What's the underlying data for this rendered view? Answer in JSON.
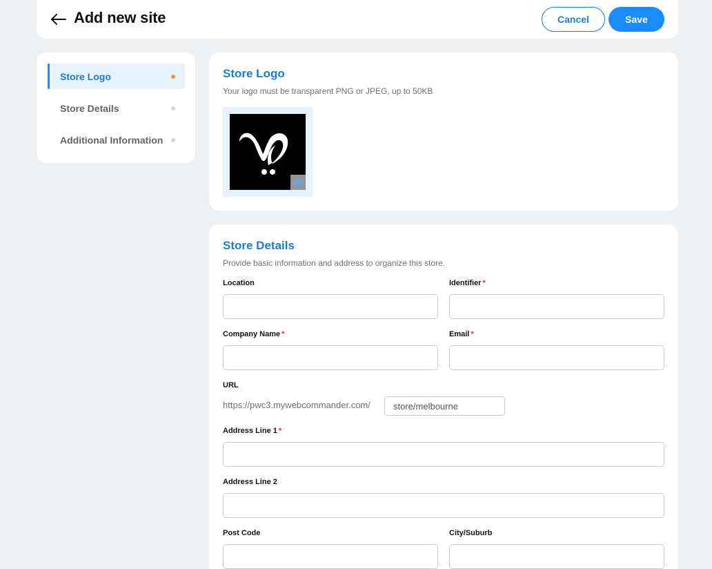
{
  "header": {
    "title": "Add new site",
    "cancel_label": "Cancel",
    "save_label": "Save"
  },
  "sidebar": {
    "items": [
      {
        "label": "Store Logo",
        "active": true
      },
      {
        "label": "Store Details",
        "active": false
      },
      {
        "label": "Additional Information",
        "active": false
      }
    ]
  },
  "store_logo": {
    "title": "Store Logo",
    "subtitle": "Your logo must be transparent PNG or JPEG, up to 50KB"
  },
  "store_details": {
    "title": "Store Details",
    "subtitle": "Provide basic information and address to organize this store.",
    "fields": {
      "location": {
        "label": "Location",
        "value": ""
      },
      "identifier": {
        "label": "Identifier",
        "value": ""
      },
      "company_name": {
        "label": "Company Name",
        "value": ""
      },
      "email": {
        "label": "Email",
        "value": ""
      },
      "url": {
        "label": "URL",
        "prefix": "https://pwc3.mywebcommander.com/",
        "value": "store/melbourne"
      },
      "address_line_1": {
        "label": "Address Line 1",
        "value": ""
      },
      "address_line_2": {
        "label": "Address Line 2",
        "value": ""
      },
      "post_code": {
        "label": "Post Code",
        "value": ""
      },
      "city_suburb": {
        "label": "City/Suburb",
        "value": ""
      }
    },
    "required_marker": "*"
  },
  "colors": {
    "accent": "#1a8cff",
    "active_dot": "#ff8c3a",
    "required": "#e03131"
  }
}
